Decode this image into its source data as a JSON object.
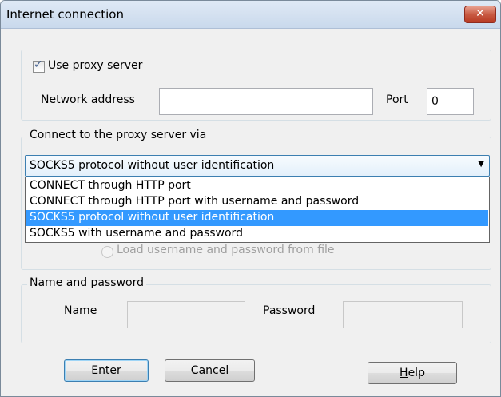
{
  "window": {
    "title": "Internet connection",
    "close_glyph": "✕"
  },
  "proxy": {
    "use_proxy_label": "Use proxy server",
    "use_proxy_checked": true,
    "network_address_label": "Network address",
    "network_address_value": "",
    "port_label": "Port",
    "port_value": "0"
  },
  "connect_via": {
    "group_label": "Connect to the proxy server via",
    "selected": "SOCKS5 protocol without user identification",
    "options": [
      "CONNECT through HTTP port",
      "CONNECT through HTTP port with username and password",
      "SOCKS5 protocol without user identification",
      "SOCKS5 with username and password"
    ],
    "selected_index": 2,
    "load_from_file_label": "Load username and password from file"
  },
  "credentials": {
    "group_label": "Name and password",
    "name_label": "Name",
    "name_value": "",
    "password_label": "Password",
    "password_value": ""
  },
  "buttons": {
    "enter": {
      "mnemonic": "E",
      "rest": "nter"
    },
    "cancel": {
      "mnemonic": "C",
      "rest": "ancel"
    },
    "help": {
      "mnemonic": "H",
      "rest": "elp"
    }
  },
  "icons": {
    "close": "close-icon",
    "dropdown": "chevron-down-icon",
    "check": "checkmark-icon"
  }
}
